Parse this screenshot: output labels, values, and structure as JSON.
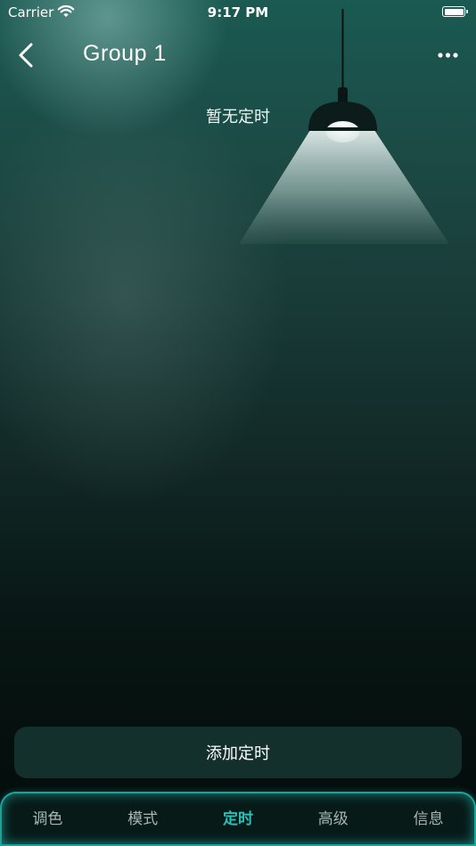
{
  "status_bar": {
    "carrier": "Carrier",
    "time": "9:17 PM",
    "icons": [
      "wifi-icon",
      "battery-icon"
    ]
  },
  "nav": {
    "title": "Group 1",
    "back_icon": "chevron-left-icon",
    "more_icon": "more-horizontal-icon"
  },
  "timer": {
    "empty_text": "暂无定时",
    "add_label": "添加定时"
  },
  "tabs": [
    {
      "label": "调色",
      "active": false
    },
    {
      "label": "模式",
      "active": false
    },
    {
      "label": "定时",
      "active": true
    },
    {
      "label": "高级",
      "active": false
    },
    {
      "label": "信息",
      "active": false
    }
  ],
  "colors": {
    "accent": "#28c2b8",
    "tab_border": "#1aa39a",
    "button_bg": "#13302c",
    "bg_top": "#1a5a52",
    "bg_bottom": "#030b0a"
  }
}
